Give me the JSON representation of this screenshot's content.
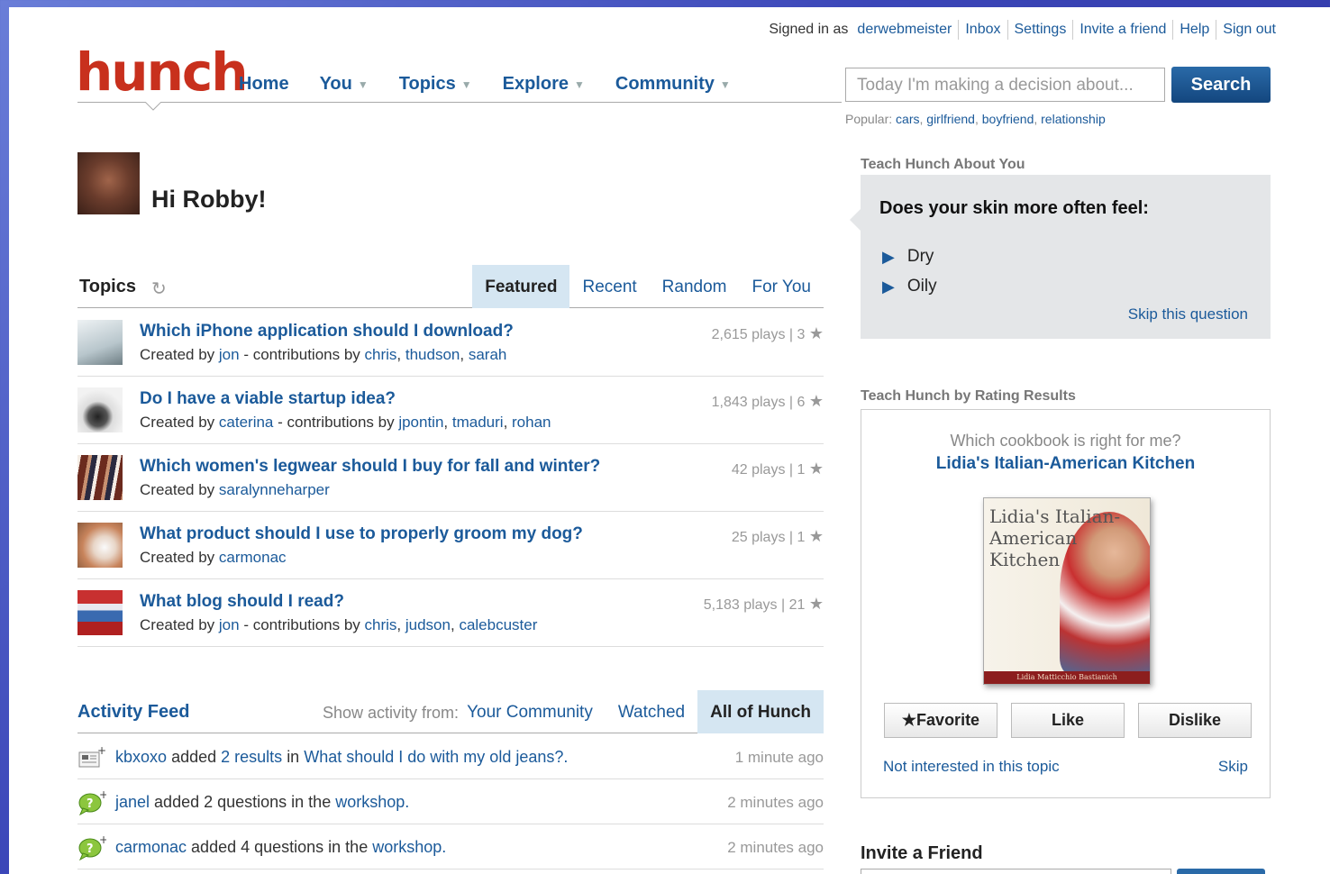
{
  "topbar": {
    "signed_in_as": "Signed in as",
    "username": "derwebmeister",
    "links": [
      "Inbox",
      "Settings",
      "Invite a friend",
      "Help",
      "Sign out"
    ]
  },
  "logo": "hunch",
  "nav": [
    {
      "label": "Home",
      "caret": false
    },
    {
      "label": "You",
      "caret": true
    },
    {
      "label": "Topics",
      "caret": true
    },
    {
      "label": "Explore",
      "caret": true
    },
    {
      "label": "Community",
      "caret": true
    }
  ],
  "search": {
    "placeholder": "Today I'm making a decision about...",
    "button": "Search",
    "popular_label": "Popular:",
    "popular": [
      "cars",
      "girlfriend",
      "boyfriend",
      "relationship"
    ]
  },
  "greeting": "Hi Robby!",
  "topics": {
    "title": "Topics",
    "tabs": [
      "Featured",
      "Recent",
      "Random",
      "For You"
    ],
    "active_tab": "Featured",
    "rows": [
      {
        "question": "Which iPhone application should I download?",
        "created_label": "Created by",
        "creator": "jon",
        "contrib_label": "- contributions by",
        "contributors": [
          "chris",
          "thudson",
          "sarah"
        ],
        "plays": "2,615 plays",
        "stars": "3",
        "thumb_color": "#d8e2e6"
      },
      {
        "question": "Do I have a viable startup idea?",
        "created_label": "Created by",
        "creator": "caterina",
        "contrib_label": "- contributions by",
        "contributors": [
          "jpontin",
          "tmaduri",
          "rohan"
        ],
        "plays": "1,843 plays",
        "stars": "6",
        "thumb_color": "#c8c8c8"
      },
      {
        "question": "Which women's legwear should I buy for fall and winter?",
        "created_label": "Created by",
        "creator": "saralynneharper",
        "contrib_label": "",
        "contributors": [],
        "plays": "42 plays",
        "stars": "1",
        "thumb_color": "#7a3b2e"
      },
      {
        "question": "What product should I use to properly groom my dog?",
        "created_label": "Created by",
        "creator": "carmonac",
        "contrib_label": "",
        "contributors": [],
        "plays": "25 plays",
        "stars": "1",
        "thumb_color": "#d9a68a"
      },
      {
        "question": "What blog should I read?",
        "created_label": "Created by",
        "creator": "jon",
        "contrib_label": "- contributions by",
        "contributors": [
          "chris",
          "judson",
          "calebcuster"
        ],
        "plays": "5,183 plays",
        "stars": "21",
        "thumb_color": "#b02828"
      }
    ]
  },
  "activity": {
    "title": "Activity Feed",
    "show_label": "Show activity from:",
    "tabs": [
      "Your Community",
      "Watched",
      "All of Hunch"
    ],
    "active_tab": "All of Hunch",
    "rows": [
      {
        "icon": "results-icon",
        "user": "kbxoxo",
        "mid1": "added",
        "link1": "2 results",
        "mid2": "in",
        "link2": "What should I do with my old jeans?",
        "time": "1 minute ago"
      },
      {
        "icon": "questions-icon",
        "user": "janel",
        "mid1": "added 2 questions in the",
        "link1": "",
        "mid2": "",
        "link2": "workshop",
        "time": "2 minutes ago"
      },
      {
        "icon": "questions-icon",
        "user": "carmonac",
        "mid1": "added 4 questions in the",
        "link1": "",
        "mid2": "",
        "link2": "workshop",
        "time": "2 minutes ago"
      }
    ]
  },
  "teach": {
    "label": "Teach Hunch About You",
    "question": "Does your skin more often feel:",
    "options": [
      "Dry",
      "Oily"
    ],
    "skip": "Skip this question"
  },
  "rating": {
    "label": "Teach Hunch by Rating Results",
    "subtitle": "Which cookbook is right for me?",
    "title": "Lidia's Italian-American Kitchen",
    "book_cover_title": "Lidia's Italian-American Kitchen",
    "book_author": "Lidia Matticchio Bastianich",
    "buttons": [
      "Favorite",
      "Like",
      "Dislike"
    ],
    "not_interested": "Not interested in this topic",
    "skip": "Skip"
  },
  "invite": {
    "title": "Invite a Friend"
  }
}
